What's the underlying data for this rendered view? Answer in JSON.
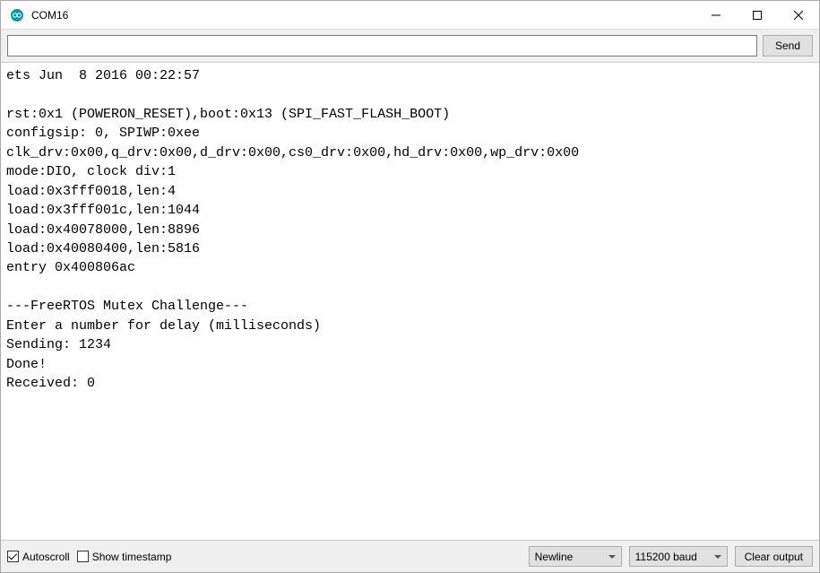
{
  "window": {
    "title": "COM16"
  },
  "toolbar": {
    "input_value": "",
    "input_placeholder": "",
    "send_label": "Send"
  },
  "console_text": "ets Jun  8 2016 00:22:57\n\nrst:0x1 (POWERON_RESET),boot:0x13 (SPI_FAST_FLASH_BOOT)\nconfigsip: 0, SPIWP:0xee\nclk_drv:0x00,q_drv:0x00,d_drv:0x00,cs0_drv:0x00,hd_drv:0x00,wp_drv:0x00\nmode:DIO, clock div:1\nload:0x3fff0018,len:4\nload:0x3fff001c,len:1044\nload:0x40078000,len:8896\nload:0x40080400,len:5816\nentry 0x400806ac\n\n---FreeRTOS Mutex Challenge---\nEnter a number for delay (milliseconds)\nSending: 1234\nDone!\nReceived: 0",
  "footer": {
    "autoscroll_label": "Autoscroll",
    "autoscroll_checked": true,
    "timestamp_label": "Show timestamp",
    "timestamp_checked": false,
    "line_ending_selected": "Newline",
    "baud_selected": "115200 baud",
    "clear_label": "Clear output"
  }
}
